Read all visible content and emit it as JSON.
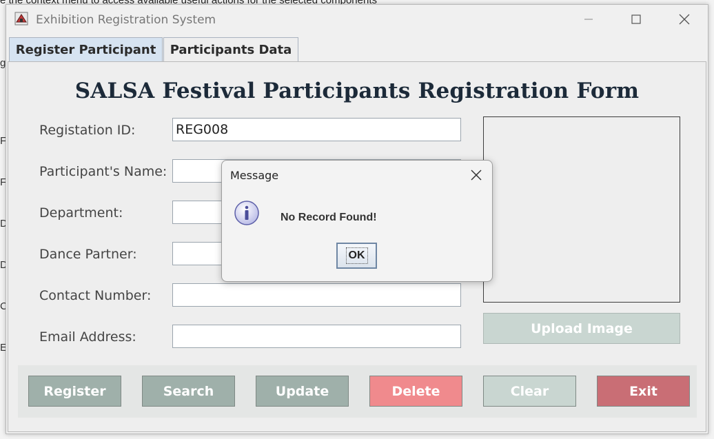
{
  "background": {
    "caption": "e the context menu to access available useful actions for the selected components",
    "edge_letters": [
      "g",
      "F",
      "F",
      "D",
      "D",
      "C",
      "E"
    ]
  },
  "window": {
    "title": "Exhibition Registration System",
    "icons": {
      "app": "app-logo-icon",
      "minimize": "minimize-icon",
      "maximize": "maximize-icon",
      "close": "close-icon"
    }
  },
  "tabs": [
    {
      "label": "Register Participant",
      "active": true
    },
    {
      "label": "Participants Data",
      "active": false
    }
  ],
  "form": {
    "title": "SALSA Festival Participants Registration Form",
    "fields": [
      {
        "label": "Registation ID:",
        "value": "REG008",
        "placeholder": ""
      },
      {
        "label": "Participant's Name:",
        "value": "",
        "placeholder": ""
      },
      {
        "label": "Department:",
        "value": "",
        "placeholder": ""
      },
      {
        "label": "Dance Partner:",
        "value": "",
        "placeholder": ""
      },
      {
        "label": "Contact Number:",
        "value": "",
        "placeholder": ""
      },
      {
        "label": "Email Address:",
        "value": "",
        "placeholder": ""
      }
    ],
    "upload_label": "Upload Image"
  },
  "actions": [
    {
      "label": "Register",
      "color": "#9fb0aa"
    },
    {
      "label": "Search",
      "color": "#9fb0aa"
    },
    {
      "label": "Update",
      "color": "#9fb0aa"
    },
    {
      "label": "Delete",
      "color": "#f08a8d"
    },
    {
      "label": "Clear",
      "color": "#c9d6d1"
    },
    {
      "label": "Exit",
      "color": "#c96e75"
    }
  ],
  "dialog": {
    "title": "Message",
    "message": "No Record Found!",
    "ok_label": "OK",
    "icons": {
      "info": "info-icon",
      "close": "close-icon"
    }
  }
}
